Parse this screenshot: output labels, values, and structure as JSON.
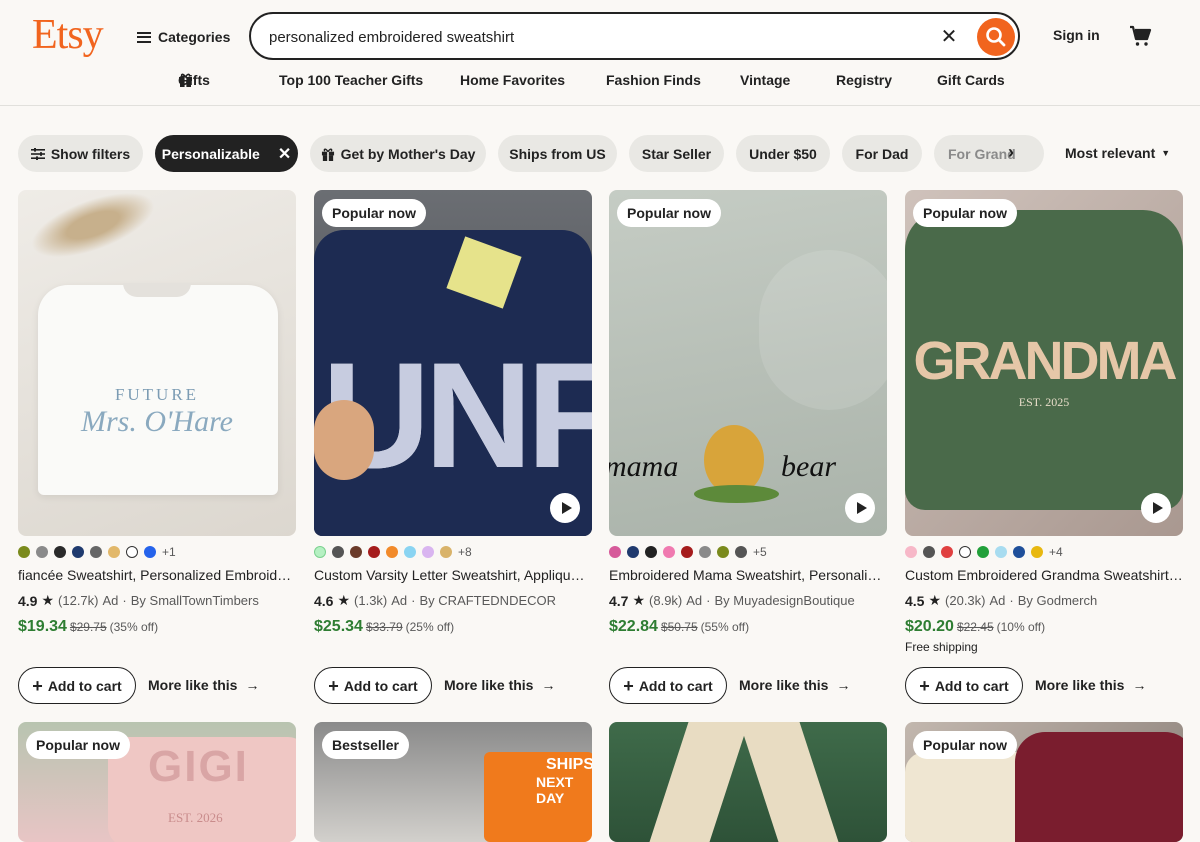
{
  "header": {
    "logo": "Etsy",
    "categories": "Categories",
    "search_value": "personalized embroidered sweatshirt",
    "sign_in": "Sign in"
  },
  "nav": [
    "Gifts",
    "Top 100 Teacher Gifts",
    "Home Favorites",
    "Fashion Finds",
    "Vintage",
    "Registry",
    "Gift Cards"
  ],
  "filters": {
    "show_filters": "Show filters",
    "personalizable": "Personalizable",
    "mothers_day": "Get by Mother's Day",
    "ships_us": "Ships from US",
    "star_seller": "Star Seller",
    "under50": "Under $50",
    "for_dad": "For Dad",
    "for_grand": "For Grand",
    "sort": "Most relevant"
  },
  "colors": {
    "accent": "#f1641e",
    "price_green": "#2e7d32",
    "chip_bg": "#e9e8e4"
  },
  "products": [
    {
      "badge": "",
      "title": "fiancée Sweatshirt, Personalized Embroidered Sweatshirt",
      "rating": "4.9",
      "reviews": "(12.7k)",
      "ad": "Ad",
      "seller": "By SmallTownTimbers",
      "price": "$19.34",
      "orig": "$29.75",
      "off": "(35% off)",
      "ship": "",
      "more_colors": "+1",
      "add": "Add to cart",
      "more": "More like this",
      "img_text1": "FUTURE",
      "img_text2": "Mrs. O'Hare"
    },
    {
      "badge": "Popular now",
      "title": "Custom Varsity Letter Sweatshirt, Applique Sweatshirt",
      "rating": "4.6",
      "reviews": "(1.3k)",
      "ad": "Ad",
      "seller": "By CRAFTEDNDECOR",
      "price": "$25.34",
      "orig": "$33.79",
      "off": "(25% off)",
      "ship": "",
      "more_colors": "+8",
      "add": "Add to cart",
      "more": "More like this",
      "img_text1": "UNF",
      "img_text2": ""
    },
    {
      "badge": "Popular now",
      "title": "Embroidered Mama Sweatshirt, Personalized Sweatshirt",
      "rating": "4.7",
      "reviews": "(8.9k)",
      "ad": "Ad",
      "seller": "By MuyadesignBoutique",
      "price": "$22.84",
      "orig": "$50.75",
      "off": "(55% off)",
      "ship": "",
      "more_colors": "+5",
      "add": "Add to cart",
      "more": "More like this",
      "img_text1": "mama",
      "img_text2": "bear"
    },
    {
      "badge": "Popular now",
      "title": "Custom Embroidered Grandma Sweatshirt, Personalized",
      "rating": "4.5",
      "reviews": "(20.3k)",
      "ad": "Ad",
      "seller": "By Godmerch",
      "price": "$20.20",
      "orig": "$22.45",
      "off": "(10% off)",
      "ship": "Free shipping",
      "more_colors": "+4",
      "add": "Add to cart",
      "more": "More like this",
      "img_text1": "GRANDMA",
      "img_text2": "EST. 2025"
    }
  ],
  "row2": [
    {
      "badge": "Popular now",
      "img_text1": "GIGI",
      "img_text2": "EST. 2026"
    },
    {
      "badge": "Bestseller",
      "img_text1": "SHIPS",
      "img_text2": "NEXT DAY"
    },
    {
      "badge": "",
      "img_text1": "",
      "img_text2": ""
    },
    {
      "badge": "Popular now",
      "img_text1": "",
      "img_text2": ""
    }
  ]
}
